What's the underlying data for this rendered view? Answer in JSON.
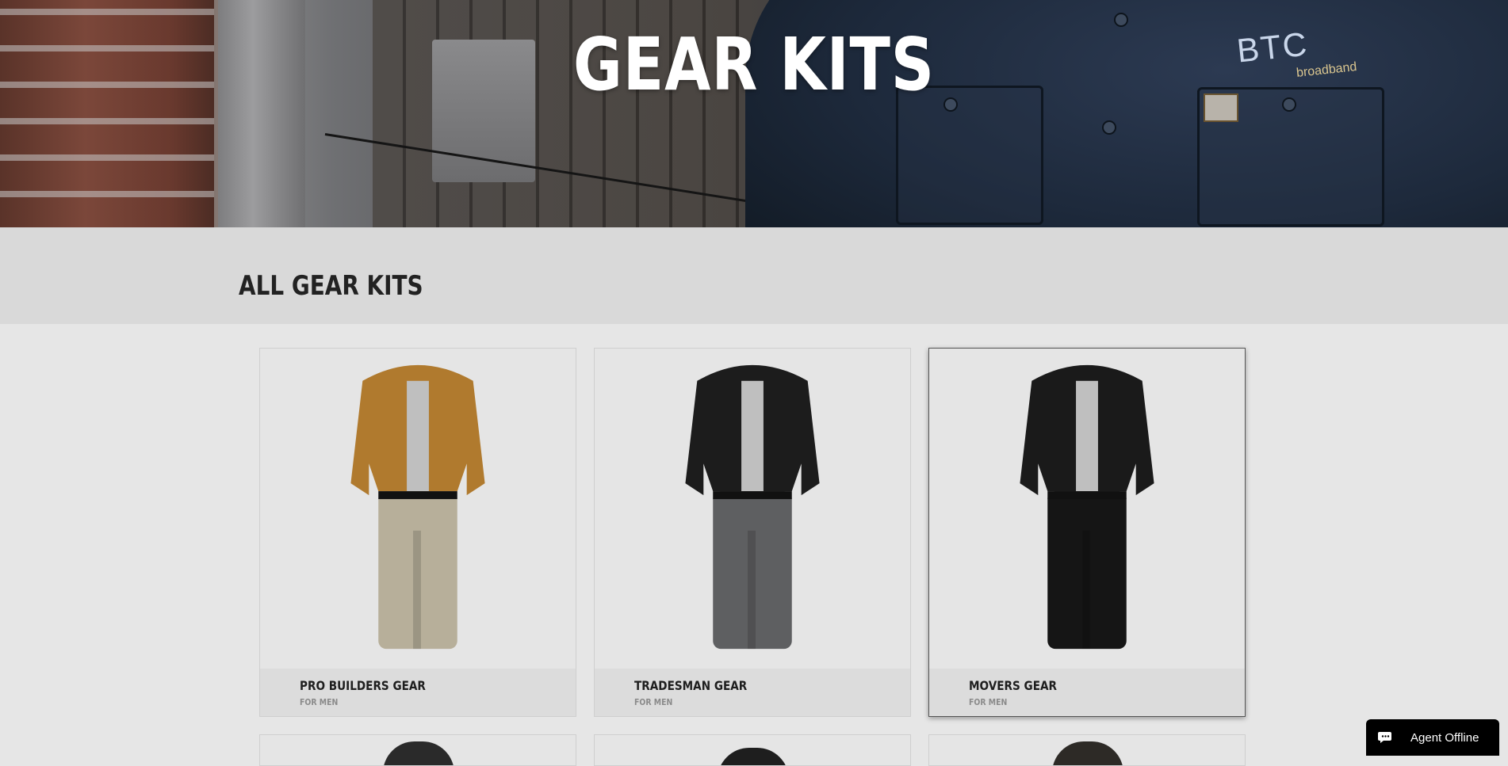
{
  "hero": {
    "title": "GEAR KITS",
    "logo_text": "BTC",
    "logo_subtext": "broadband"
  },
  "section": {
    "title": "ALL GEAR KITS"
  },
  "kits": [
    {
      "name": "PRO BUILDERS GEAR",
      "audience": "FOR MEN",
      "jacket_color": "#b07a2e",
      "pants_color": "#b7af9a"
    },
    {
      "name": "TRADESMAN GEAR",
      "audience": "FOR MEN",
      "jacket_color": "#1c1c1c",
      "pants_color": "#5e5f61"
    },
    {
      "name": "MOVERS GEAR",
      "audience": "FOR MEN",
      "jacket_color": "#1a1a1a",
      "pants_color": "#151515"
    }
  ],
  "chat": {
    "label": "Agent Offline"
  },
  "colors": {
    "page_bg": "#e6e6e6",
    "section_bg": "#d9d9d9",
    "caption_bg": "#dcdcdc",
    "chat_bg": "#000000"
  }
}
